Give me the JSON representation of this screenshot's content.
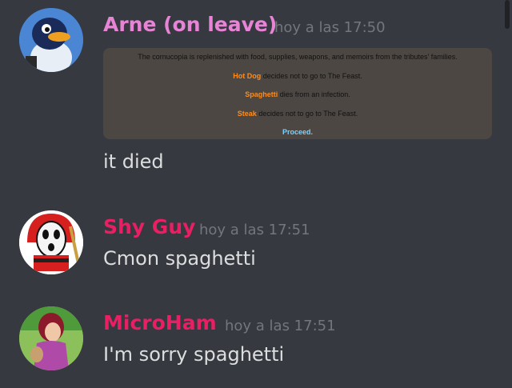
{
  "messages": [
    {
      "author": "Arne (on leave)",
      "author_color": "#e784d6",
      "timestamp": "hoy a las 17:50",
      "embed": {
        "intro": "The cornucopia is replenished with food, supplies, weapons, and memoirs from the tributes' families.",
        "events": [
          {
            "name": "Hot Dog",
            "text": "decides not to go to The Feast."
          },
          {
            "name": "Spaghetti",
            "text": "dies from an infection."
          },
          {
            "name": "Steak",
            "text": "decides not to go to The Feast."
          }
        ],
        "proceed": "Proceed."
      },
      "text": "it died"
    },
    {
      "author": "Shy Guy",
      "author_color": "#e91e63",
      "timestamp": "hoy a las 17:51",
      "text": "Cmon spaghetti"
    },
    {
      "author": "MicroHam",
      "author_color": "#e91e63",
      "timestamp": "hoy a las 17:51",
      "text": "I'm sorry spaghetti"
    }
  ]
}
